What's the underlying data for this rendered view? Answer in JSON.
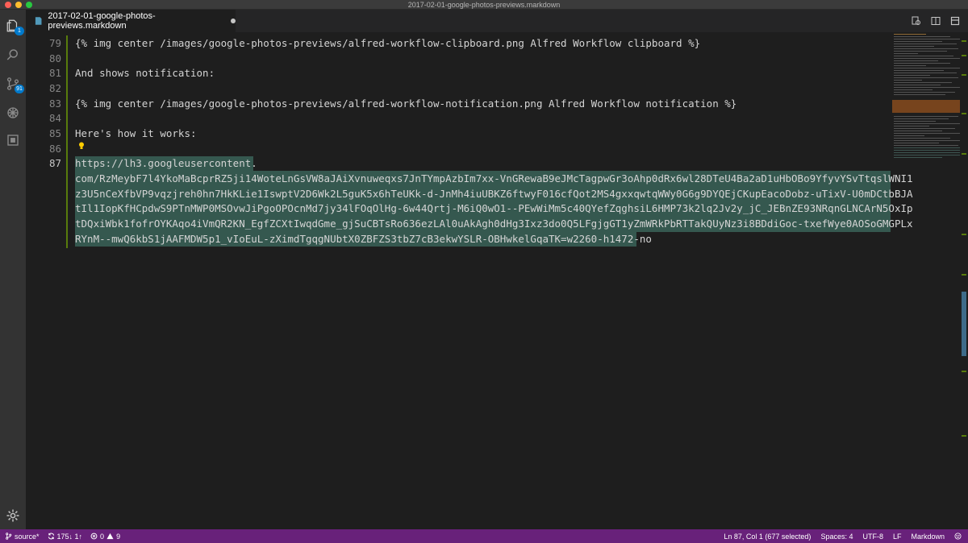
{
  "window": {
    "title": "2017-02-01-google-photos-previews.markdown"
  },
  "activity_bar": {
    "explorer_badge": "1",
    "scm_badge": "91"
  },
  "tab": {
    "label": "2017-02-01-google-photos-previews.markdown",
    "dirty": true
  },
  "editor": {
    "lines": [
      {
        "number": "79",
        "text": "{% img center /images/google-photos-previews/alfred-workflow-clipboard.png Alfred Workflow clipboard %}"
      },
      {
        "number": "80",
        "text": ""
      },
      {
        "number": "81",
        "text": "And shows notification:"
      },
      {
        "number": "82",
        "text": ""
      },
      {
        "number": "83",
        "text": "{% img center /images/google-photos-previews/alfred-workflow-notification.png Alfred Workflow notification %}"
      },
      {
        "number": "84",
        "text": ""
      },
      {
        "number": "85",
        "text": "Here's how it works:"
      },
      {
        "number": "86",
        "text": ""
      },
      {
        "number": "87",
        "text": ""
      }
    ],
    "selected_url_lines": [
      "https://lh3.googleusercontent.",
      "com/RzMeybF7l4YkoMaBcprRZ5ji14WoteLnGsVW8aJAiXvnuweqxs7JnTYmpAzbIm7xx-VnGRewaB9eJMcTagpwGr3oAhp0dRx6wl28DTeU4Ba2aD1uHbOBo9YfyvYSvTtqslWNI1",
      "z3U5nCeXfbVP9vqzjreh0hn7HkKLie1IswptV2D6Wk2L5guK5x6hTeUKk-d-JnMh4iuUBKZ6ftwyF016cfQot2MS4gxxqwtqWWy0G6g9DYQEjCKupEacoDobz-uTixV-U0mDCtbBJA",
      "tIl1IopKfHCpdwS9PTnMWP0MSOvwJiPgoOPOcnMd7jy34lFOqOlHg-6w44Qrtj-M6iQ0wO1--PEwWiMm5c40QYefZqghsiL6HMP73k2lq2Jv2y_jC_JEBnZE93NRqnGLNCArN5OxIp",
      "tDQxiWbk1fofrOYKAqo4iVmQR2KN_EgfZCXtIwqdGme_gjSuCBTsRo636ezLAl0uAkAgh0dHg3Ixz3do0Q5LFgjgGT1yZmWRkPbRTTakQUyNz3i8BDdiGoc-txefWye0AOSoGMGPLx",
      "RYnM--mwQ6kbS1jAAFMDW5p1_vIoEuL-zXimdTgqgNUbtX0ZBFZS3tbZ7cB3ekwYSLR-OBHwkelGqaTK=w2260-h1472-no"
    ]
  },
  "statusbar": {
    "branch": "source*",
    "sync": "175↓ 1↑",
    "errors": "0",
    "warnings": "9",
    "position": "Ln 87, Col 1 (677 selected)",
    "spaces": "Spaces: 4",
    "encoding": "UTF-8",
    "eol": "LF",
    "language": "Markdown"
  },
  "colors": {
    "statusbar": "#68217a",
    "activity_bar": "#333333",
    "editor_bg": "#1e1e1e",
    "selection": "#35584f",
    "badge": "#007acc"
  }
}
